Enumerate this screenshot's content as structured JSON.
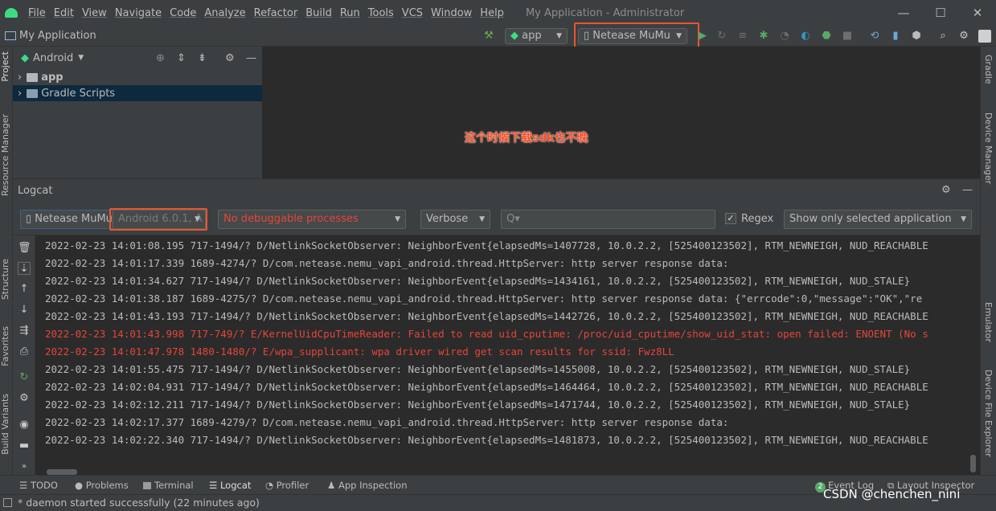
{
  "menubar": {
    "items": [
      "File",
      "Edit",
      "View",
      "Navigate",
      "Code",
      "Analyze",
      "Refactor",
      "Build",
      "Run",
      "Tools",
      "VCS",
      "Window",
      "Help"
    ],
    "title": "My Application - Administrator"
  },
  "toolbar": {
    "project_name": "My Application",
    "run_config": "app",
    "device": "Netease MuMu"
  },
  "left_strip": {
    "project": "Project",
    "resource_manager": "Resource Manager",
    "structure": "Structure",
    "favorites": "Favorites",
    "build_variants": "Build Variants"
  },
  "right_strip": {
    "gradle": "Gradle",
    "device_manager": "Device Manager",
    "emulator": "Emulator",
    "device_file_explorer": "Device File Explorer"
  },
  "project_panel": {
    "view_selector": "Android",
    "tree": [
      "app",
      "Gradle Scripts"
    ]
  },
  "editor": {
    "note": "这个时候下载sdk也不晚"
  },
  "logcat": {
    "title": "Logcat",
    "device": "Netease MuMu",
    "api": "Android 6.0.1, A",
    "process": "No debuggable processes",
    "level": "Verbose",
    "search_placeholder": "Q▾",
    "regex_label": "Regex",
    "filter": "Show only selected application",
    "lines": [
      {
        "text": "2022-02-23 14:01:08.195 717-1494/? D/NetlinkSocketObserver: NeighborEvent{elapsedMs=1407728, 10.0.2.2, [525400123502], RTM_NEWNEIGH, NUD_REACHABLE",
        "level": "debug"
      },
      {
        "text": "2022-02-23 14:01:17.339 1689-4274/? D/com.netease.nemu_vapi_android.thread.HttpServer: http server response data:",
        "level": "debug"
      },
      {
        "text": "2022-02-23 14:01:34.627 717-1494/? D/NetlinkSocketObserver: NeighborEvent{elapsedMs=1434161, 10.0.2.2, [525400123502], RTM_NEWNEIGH, NUD_STALE}",
        "level": "debug"
      },
      {
        "text": "2022-02-23 14:01:38.187 1689-4275/? D/com.netease.nemu_vapi_android.thread.HttpServer: http server response data: {\"errcode\":0,\"message\":\"OK\",\"re",
        "level": "debug"
      },
      {
        "text": "2022-02-23 14:01:43.193 717-1494/? D/NetlinkSocketObserver: NeighborEvent{elapsedMs=1442726, 10.0.2.2, [525400123502], RTM_NEWNEIGH, NUD_REACHABLE",
        "level": "debug"
      },
      {
        "text": "2022-02-23 14:01:43.998 717-749/? E/KernelUidCpuTimeReader: Failed to read uid_cputime: /proc/uid_cputime/show_uid_stat: open failed: ENOENT (No s",
        "level": "error"
      },
      {
        "text": "2022-02-23 14:01:47.978 1480-1480/? E/wpa_supplicant: wpa driver wired get scan results for ssid: Fwz8LL",
        "level": "error"
      },
      {
        "text": "2022-02-23 14:01:55.475 717-1494/? D/NetlinkSocketObserver: NeighborEvent{elapsedMs=1455008, 10.0.2.2, [525400123502], RTM_NEWNEIGH, NUD_STALE}",
        "level": "debug"
      },
      {
        "text": "2022-02-23 14:02:04.931 717-1494/? D/NetlinkSocketObserver: NeighborEvent{elapsedMs=1464464, 10.0.2.2, [525400123502], RTM_NEWNEIGH, NUD_REACHABLE",
        "level": "debug"
      },
      {
        "text": "2022-02-23 14:02:12.211 717-1494/? D/NetlinkSocketObserver: NeighborEvent{elapsedMs=1471744, 10.0.2.2, [525400123502], RTM_NEWNEIGH, NUD_STALE}",
        "level": "debug"
      },
      {
        "text": "2022-02-23 14:02:17.377 1689-4279/? D/com.netease.nemu_vapi_android.thread.HttpServer: http server response data:",
        "level": "debug"
      },
      {
        "text": "2022-02-23 14:02:22.340 717-1494/? D/NetlinkSocketObserver: NeighborEvent{elapsedMs=1481873, 10.0.2.2, [525400123502], RTM_NEWNEIGH, NUD_REACHABLE",
        "level": "debug"
      }
    ]
  },
  "bottom_tabs": {
    "todo": "TODO",
    "problems": "Problems",
    "terminal": "Terminal",
    "logcat": "Logcat",
    "profiler": "Profiler",
    "app_inspection": "App Inspection",
    "event_log_count": "2",
    "event_log": "Event Log",
    "layout_inspector": "Layout Inspector"
  },
  "status": {
    "message": "* daemon started successfully (22 minutes ago)"
  },
  "watermark": "CSDN @chenchen_nini",
  "colors": {
    "highlight": "#e8562d",
    "error_text": "#e5453a",
    "note_text": "#ff4a22",
    "android_green": "#3ddc84",
    "run_green": "#59a869"
  }
}
